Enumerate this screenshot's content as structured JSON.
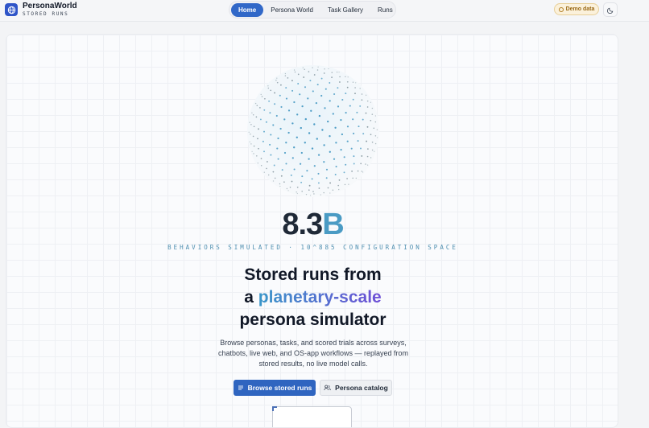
{
  "brand": {
    "name": "PersonaWorld",
    "subtitle": "STORED RUNS"
  },
  "nav": [
    {
      "label": "Home",
      "active": true
    },
    {
      "label": "Persona World",
      "active": false
    },
    {
      "label": "Task Gallery",
      "active": false
    },
    {
      "label": "Runs",
      "active": false
    }
  ],
  "header": {
    "demo_label": "Demo data",
    "theme_icon": "moon-icon"
  },
  "hero": {
    "stat_number": "8.3",
    "stat_unit": "B",
    "caption": "BEHAVIORS SIMULATED · 10^885 CONFIGURATION SPACE",
    "headline_line1": "Stored runs from",
    "headline_a": "a",
    "headline_highlight": "planetary-scale",
    "headline_line3": "persona simulator",
    "description": "Browse personas, tasks, and scored trials across surveys, chatbots, live web, and OS-app workflows — replayed from stored results, no live model calls.",
    "primary_button": "Browse stored runs",
    "secondary_button": "Persona catalog"
  },
  "colors": {
    "accent": "#3168c8",
    "highlight_start": "#3a96c9",
    "highlight_end": "#6f4fd6",
    "globe_dot": "#4a9bc4"
  }
}
